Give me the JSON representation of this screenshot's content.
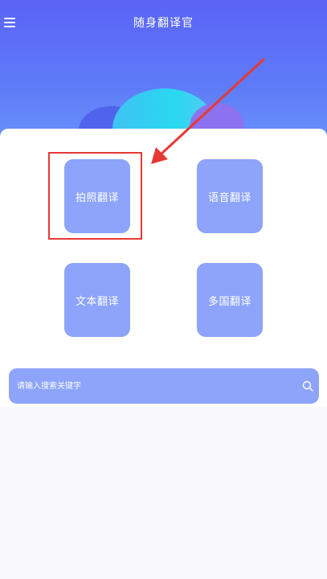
{
  "header": {
    "title": "随身翻译官",
    "menu_icon": "hamburger-menu-icon"
  },
  "tiles": [
    {
      "label": "拍照翻译"
    },
    {
      "label": "语音翻译"
    },
    {
      "label": "文本翻译"
    },
    {
      "label": "多国翻译"
    }
  ],
  "search": {
    "placeholder": "请输入搜索关键字",
    "value": "",
    "icon": "search-icon"
  },
  "colors": {
    "header_top": "#5a63f6",
    "tile": "#8da4fa",
    "annotation": "#e53935"
  }
}
